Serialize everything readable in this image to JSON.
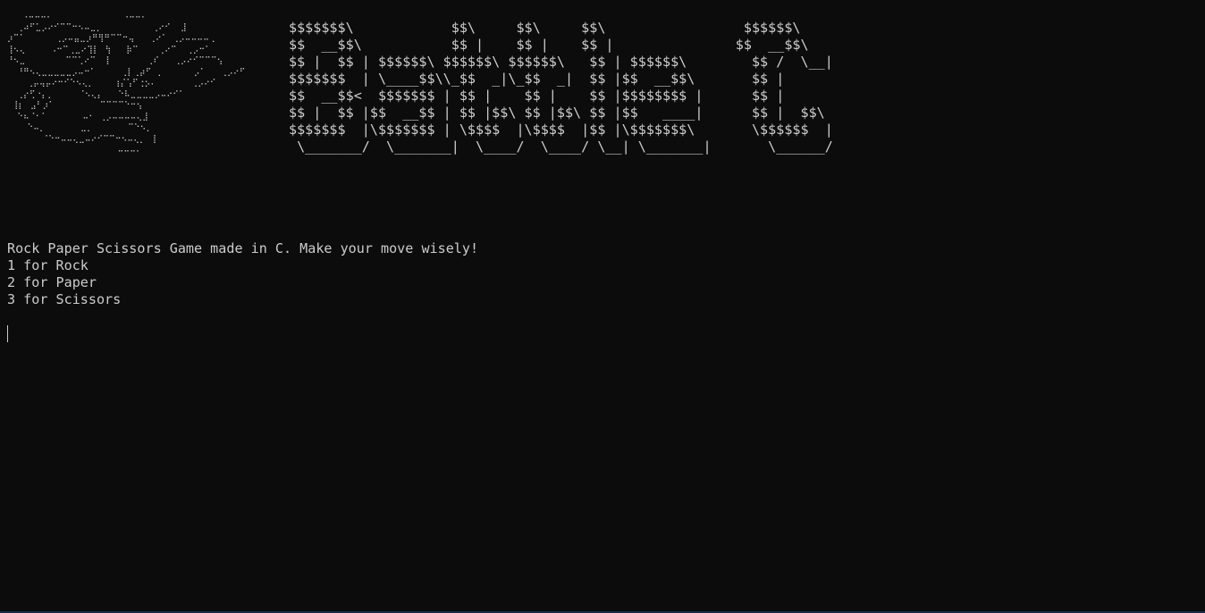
{
  "terminal": {
    "background_color": "#0c0c0c",
    "text_color": "#cccccc",
    "logo_art_lines": [
      "   ⠠⠤⠤⠤⠄              ⠠⠤⠤⠄",
      "  ⢀⠴⠋⣁⡠⠔⠊⠉⠉⠒⠢⠤⣀⡀          ⢀⠔⠊  ⣸",
      "⡰⠉⠁      ⢀⡠⠤⣤⣀⡰⠛⢻⠛⠉⠉⠒⢤   ⢀⠔⠁ ⢀⡠⠤⠤⠤⠤⢀",
      "⢸⠢⢄     ⠠⠒⠉⢀⣀⠔⢹⡇⠀⢳   ⡷⠉    ⢀⠔⠉  ⢀⡠⠒⠁",
      "⠘⠢⣀        ⠉⠉⢁⠔⠉  ⡇       ⢀⠎   ⢀⡠⠔⠊⠉⠉⠉⢢",
      "  ⠘⠛⠢⢄⣀⣀⣀⣀⣀⡠⠤⠒⠁     ⢀⡇⢀⡴⠋⠀⡀      ⡠⠁   ⢀⡠⠔⠋",
      "    ⢀⡤⢤⡤⠔⠒⠊⠑⠢⢄⡀    ⢰⡌⢡⠋⢐⡢⠄       ⢀⡠⠔⠊",
      "  ⢀⡔⢋⠐⡄⡀     ⠈⠢⢄⡄   ⠑⠧⣀⣀⣀⣀⡠⠤⠔⠊⠁",
      " ⢸⡆⠀⣠⠃⡰⠁         ⠉⠉⠉⠉⠑⠒⢢",
      "  ⠑⠦⠈⠂⠁       ⠤⠂ ⢀⡠⠤⠤⠤⠤⢄⣸",
      "    ⠑⠤⡀       ⣀⡀       ⠉⠑⠢⡀",
      "       ⠈⠑⠒⠤⠤⢄⣀⠤⠔⠊⠉⠉⠒⠢⠤⢄⡀ ⢸",
      "                      ⠤⠤⠤⠄"
    ],
    "banner_art_lines": [
      "$$$$$$$\\            $$\\     $$\\     $$\\                 $$$$$$\\",
      "$$  __$$\\           $$ |    $$ |    $$ |               $$  __$$\\",
      "$$ |  $$ | $$$$$$\\ $$$$$$\\ $$$$$$\\   $$ | $$$$$$\\        $$ /  \\__|",
      "$$$$$$$  | \\____$$\\\\_$$  _|\\_$$  _|  $$ |$$  __$$\\       $$ |",
      "$$  __$$<  $$$$$$$ | $$ |    $$ |    $$ |$$$$$$$$ |      $$ |",
      "$$ |  $$ |$$  __$$ | $$ |$$\\ $$ |$$\\ $$ |$$   ____|      $$ |  $$\\",
      "$$$$$$$  |\\$$$$$$$ | \\$$$$  |\\$$$$  |$$ |\\$$$$$$$\\       \\$$$$$$  |",
      " \\_______/  \\_______|  \\____/  \\____/ \\__| \\_______|       \\______/"
    ],
    "output_lines": [
      "Rock Paper Scissors Game made in C. Make your move wisely!",
      "1 for Rock",
      "2 for Paper",
      "3 for Scissors"
    ]
  }
}
